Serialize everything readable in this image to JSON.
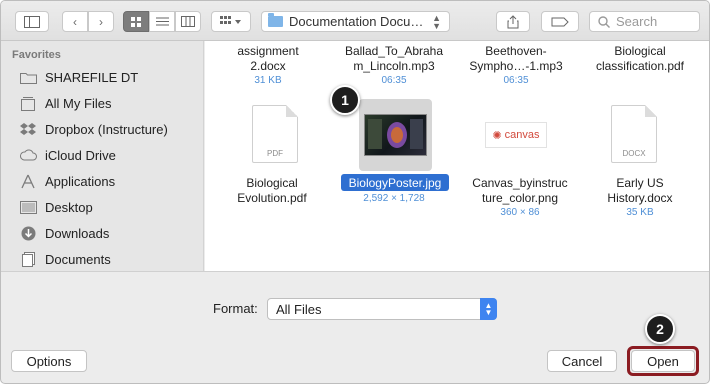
{
  "toolbar": {
    "path_label": "Documentation Docu…",
    "search_placeholder": "Search"
  },
  "sidebar": {
    "heading": "Favorites",
    "items": [
      {
        "label": "SHAREFILE DT",
        "icon": "folder-icon"
      },
      {
        "label": "All My Files",
        "icon": "all-files-icon"
      },
      {
        "label": "Dropbox (Instructure)",
        "icon": "dropbox-icon"
      },
      {
        "label": "iCloud Drive",
        "icon": "cloud-icon"
      },
      {
        "label": "Applications",
        "icon": "applications-icon"
      },
      {
        "label": "Desktop",
        "icon": "desktop-icon"
      },
      {
        "label": "Downloads",
        "icon": "downloads-icon"
      },
      {
        "label": "Documents",
        "icon": "documents-icon"
      }
    ]
  },
  "files": {
    "row1": [
      {
        "name_line1": "assignment",
        "name_line2": "2.docx",
        "meta": "31 KB"
      },
      {
        "name_line1": "Ballad_To_Abraha",
        "name_line2": "m_Lincoln.mp3",
        "meta": "06:35"
      },
      {
        "name_line1": "Beethoven-",
        "name_line2": "Sympho…-1.mp3",
        "meta": "06:35"
      },
      {
        "name_line1": "Biological",
        "name_line2": "classification.pdf",
        "meta": ""
      }
    ],
    "row2": [
      {
        "name_line1": "Biological",
        "name_line2": "Evolution.pdf",
        "meta": "",
        "doc_label": "PDF"
      },
      {
        "name_line1": "BiologyPoster.jpg",
        "name_line2": "",
        "meta": "2,592 × 1,728"
      },
      {
        "name_line1": "Canvas_byinstruc",
        "name_line2": "ture_color.png",
        "meta": "360 × 86",
        "thumb_text": "canvas"
      },
      {
        "name_line1": "Early US",
        "name_line2": "History.docx",
        "meta": "35 KB",
        "doc_label": "DOCX"
      }
    ]
  },
  "format": {
    "label": "Format:",
    "value": "All Files"
  },
  "buttons": {
    "options": "Options",
    "cancel": "Cancel",
    "open": "Open"
  },
  "badges": {
    "one": "1",
    "two": "2"
  },
  "colors": {
    "accent": "#2e6fd1",
    "highlight": "#8b1c22",
    "meta": "#4f8fd6"
  }
}
